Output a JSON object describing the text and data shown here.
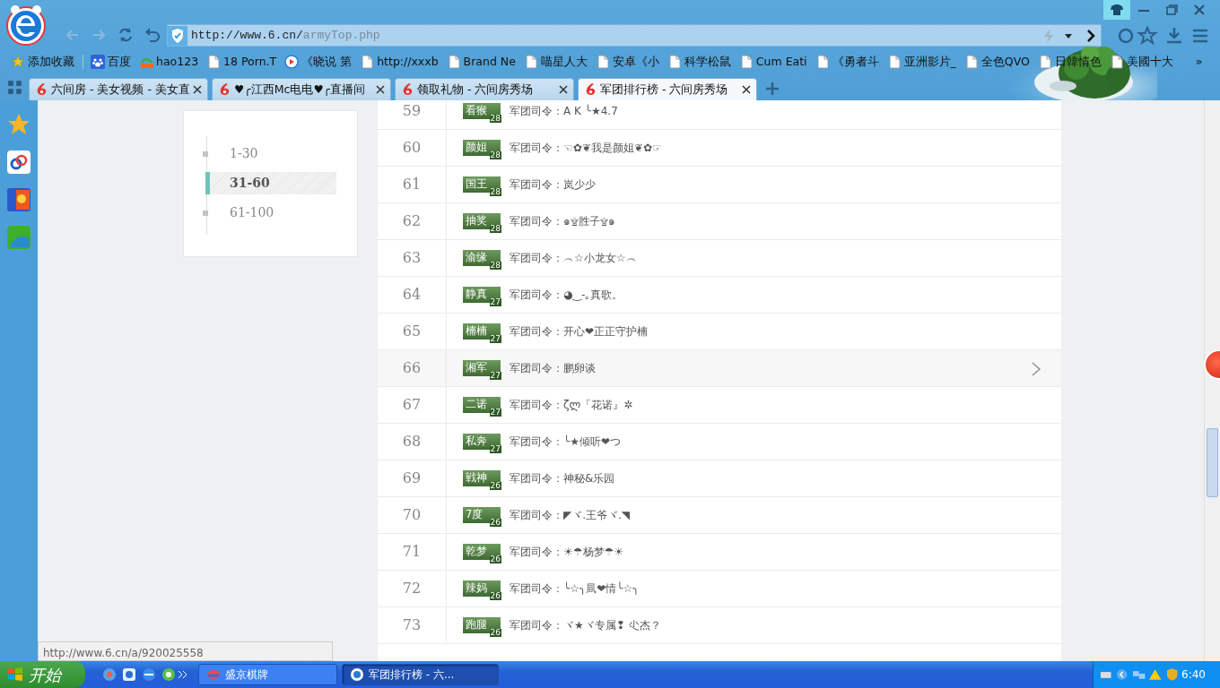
{
  "browser": {
    "address": {
      "host": "http://www.6.cn/",
      "path": "armyTop.php"
    },
    "bookmarks": [
      {
        "label": "添加收藏",
        "kind": "star"
      },
      {
        "label": "百度",
        "kind": "paw"
      },
      {
        "label": "hao123",
        "kind": "hao"
      },
      {
        "label": "18 Porn.T",
        "kind": "page"
      },
      {
        "label": "《晓说 第",
        "kind": "play"
      },
      {
        "label": "http://xxxb",
        "kind": "page"
      },
      {
        "label": "Brand Ne",
        "kind": "page"
      },
      {
        "label": "喵星人大",
        "kind": "page"
      },
      {
        "label": "安卓《小",
        "kind": "page"
      },
      {
        "label": "科学松鼠",
        "kind": "page"
      },
      {
        "label": "Cum Eati",
        "kind": "page"
      },
      {
        "label": "《勇者斗",
        "kind": "page"
      },
      {
        "label": "亚洲影片_",
        "kind": "page"
      },
      {
        "label": "全色QVO",
        "kind": "page"
      },
      {
        "label": "日韓情色",
        "kind": "page"
      },
      {
        "label": "美國十大",
        "kind": "page"
      }
    ],
    "more": "»",
    "tabs": [
      {
        "title": "六间房 - 美女视频 - 美女直",
        "selected": false
      },
      {
        "title": "♥╭江西Mc电电♥╭直播间",
        "selected": false
      },
      {
        "title": "领取礼物 - 六间房秀场",
        "selected": false
      },
      {
        "title": "军团排行榜 - 六间房秀场",
        "selected": true
      }
    ],
    "status_url": "http://www.6.cn/a/920025558"
  },
  "pager": [
    {
      "label": "1-30",
      "selected": false
    },
    {
      "label": "31-60",
      "selected": true
    },
    {
      "label": "61-100",
      "selected": false
    }
  ],
  "ranks": [
    {
      "rank": "59",
      "badge": "看猴",
      "badge_level": "28",
      "text": "军团司令：A K ╰★4.7",
      "hovered": false
    },
    {
      "rank": "60",
      "badge": "颜姐",
      "badge_level": "28",
      "text": "军团司令：☜✿❦我是颜姐❦✿☞",
      "hovered": false
    },
    {
      "rank": "61",
      "badge": "国王",
      "badge_level": "28",
      "text": "军团司令：岚少少",
      "hovered": false
    },
    {
      "rank": "62",
      "badge": "抽奖",
      "badge_level": "28",
      "text": "军团司令：๑۩胜子۩๑",
      "hovered": false
    },
    {
      "rank": "63",
      "badge": "渝缘",
      "badge_level": "28",
      "text": "军团司令：︵☆小龙女☆︵",
      "hovered": false
    },
    {
      "rank": "64",
      "badge": "静真",
      "badge_level": "27",
      "text": "军团司令：◕‿-｡真歌。",
      "hovered": false
    },
    {
      "rank": "65",
      "badge": "楠楠",
      "badge_level": "27",
      "text": "军团司令：开心❤正正守护楠",
      "hovered": false
    },
    {
      "rank": "66",
      "badge": "湘军",
      "badge_level": "27",
      "text": "军团司令：鹏卵谈",
      "hovered": true
    },
    {
      "rank": "67",
      "badge": "二诺",
      "badge_level": "27",
      "text": "军团司令：ζლ「花诺』✲",
      "hovered": false
    },
    {
      "rank": "68",
      "badge": "私奔",
      "badge_level": "27",
      "text": "军团司令：╰★倾听❤つ",
      "hovered": false
    },
    {
      "rank": "69",
      "badge": "戦神",
      "badge_level": "26",
      "text": "军团司令：神秘&乐园",
      "hovered": false
    },
    {
      "rank": "70",
      "badge": "7度",
      "badge_level": "26",
      "text": "军团司令：◤ヾ.王爷ヾ.◥",
      "hovered": false
    },
    {
      "rank": "71",
      "badge": "乾梦",
      "badge_level": "26",
      "text": "军团司令：☀☂杨梦☂☀",
      "hovered": false
    },
    {
      "rank": "72",
      "badge": "辣妈",
      "badge_level": "26",
      "text": "军团司令：╰☆╮凬❤情╰☆╮",
      "hovered": false
    },
    {
      "rank": "73",
      "badge": "跑腿",
      "badge_level": "26",
      "text": "军团司令：ヾ★ヾ专属❢ 尐杰？",
      "hovered": false
    }
  ],
  "taskbar": {
    "start": "开始",
    "tasks": [
      {
        "label": "盛京棋牌",
        "selected": false
      },
      {
        "label": "军团排行榜 - 六...",
        "selected": true
      }
    ],
    "clock": "6:40"
  }
}
